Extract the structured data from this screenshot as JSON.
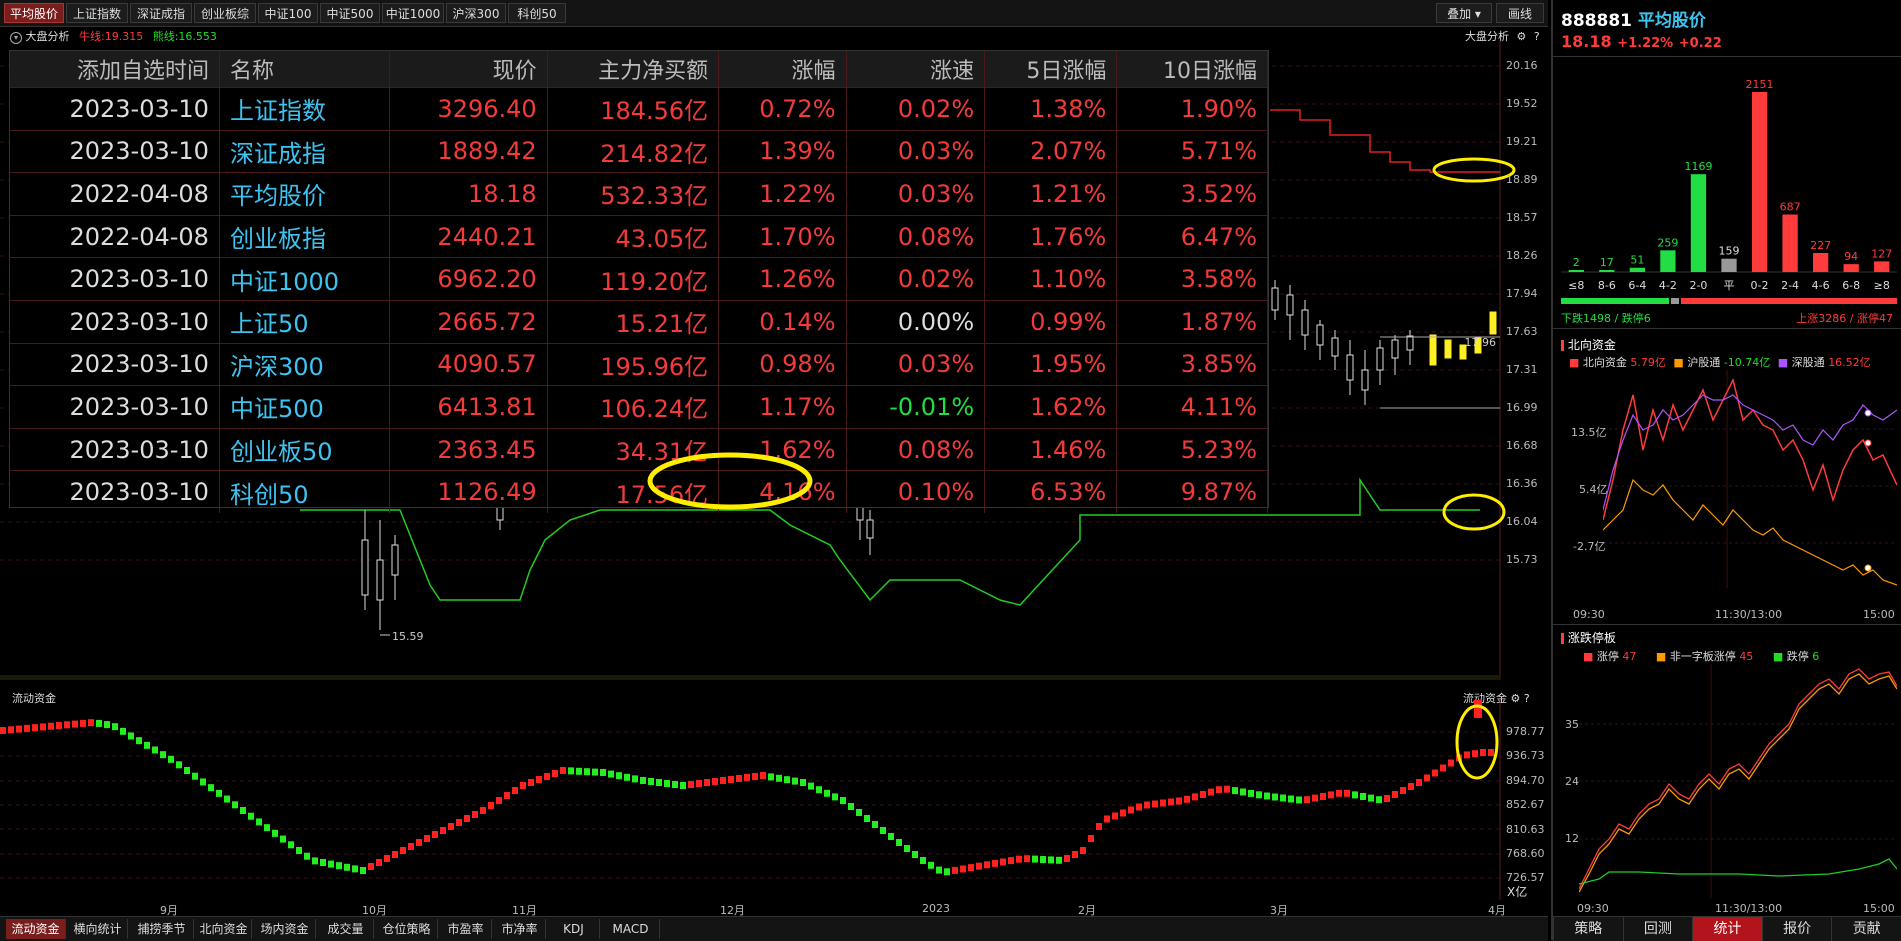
{
  "top_tabs": [
    "平均股价",
    "上证指数",
    "深证成指",
    "创业板综",
    "中证100",
    "中证500",
    "中证1000",
    "沪深300",
    "科创50"
  ],
  "active_top_tab": 0,
  "toolbar": {
    "overlay_label": "叠加",
    "line_label": "画线"
  },
  "main_header": {
    "title": "大盘分析",
    "mid_label": "牛线:19.315",
    "mid_color": "#ff3b3b",
    "low_label": "熊线:16.553",
    "low_color": "#22dd22",
    "right_title": "大盘分析"
  },
  "price_axis": [
    "20.16",
    "19.52",
    "19.21",
    "18.89",
    "18.57",
    "18.26",
    "17.94",
    "17.63",
    "17.31",
    "16.99",
    "16.68",
    "16.36",
    "16.04",
    "15.73"
  ],
  "annotations": {
    "low_label": "15.59",
    "price_mark": "17.96"
  },
  "table": {
    "headers": [
      "添加自选时间",
      "名称",
      "现价",
      "主力净买额",
      "涨幅",
      "涨速",
      "5日涨幅",
      "10日涨幅"
    ],
    "rows": [
      [
        "2023-03-10",
        "上证指数",
        "3296.40",
        "184.56亿",
        "0.72%",
        "0.02%",
        "1.38%",
        "1.90%"
      ],
      [
        "2023-03-10",
        "深证成指",
        "1889.42",
        "214.82亿",
        "1.39%",
        "0.03%",
        "2.07%",
        "5.71%"
      ],
      [
        "2022-04-08",
        "平均股价",
        "18.18",
        "532.33亿",
        "1.22%",
        "0.03%",
        "1.21%",
        "3.52%"
      ],
      [
        "2022-04-08",
        "创业板指",
        "2440.21",
        "43.05亿",
        "1.70%",
        "0.08%",
        "1.76%",
        "6.47%"
      ],
      [
        "2023-03-10",
        "中证1000",
        "6962.20",
        "119.20亿",
        "1.26%",
        "0.02%",
        "1.10%",
        "3.58%"
      ],
      [
        "2023-03-10",
        "上证50",
        "2665.72",
        "15.21亿",
        "0.14%",
        "0.00%",
        "0.99%",
        "1.87%"
      ],
      [
        "2023-03-10",
        "沪深300",
        "4090.57",
        "195.96亿",
        "0.98%",
        "0.03%",
        "1.95%",
        "3.85%"
      ],
      [
        "2023-03-10",
        "中证500",
        "6413.81",
        "106.24亿",
        "1.17%",
        "-0.01%",
        "1.62%",
        "4.11%"
      ],
      [
        "2023-03-10",
        "创业板50",
        "2363.45",
        "34.31亿",
        "1.62%",
        "0.08%",
        "1.46%",
        "5.23%"
      ],
      [
        "2023-03-10",
        "科创50",
        "1126.49",
        "17.56亿",
        "4.16%",
        "0.10%",
        "6.53%",
        "9.87%"
      ]
    ]
  },
  "flow": {
    "title": "流动资金",
    "right_title": "流动资金",
    "axis": [
      "978.77",
      "936.73",
      "894.70",
      "852.67",
      "810.63",
      "768.60",
      "726.57"
    ],
    "unit": "X亿"
  },
  "months": [
    "9月",
    "10月",
    "11月",
    "12月",
    "2023",
    "2月",
    "3月",
    "4月"
  ],
  "bottom_tabs": [
    "流动资金",
    "横向统计",
    "捕捞季节",
    "北向资金",
    "场内资金",
    "成交量",
    "仓位策略",
    "市盈率",
    "市净率",
    "KDJ",
    "MACD"
  ],
  "active_bottom_tab": 0,
  "right": {
    "code": "888881",
    "name": "平均股价",
    "price": "18.18",
    "pct": "+1.22%",
    "chg": "+0.22",
    "dist": {
      "chart_data": {
        "type": "bar",
        "categories": [
          "≤8",
          "8-6",
          "6-4",
          "4-2",
          "2-0",
          "平",
          "0-2",
          "2-4",
          "4-6",
          "6-8",
          "≥8"
        ],
        "values": [
          2,
          17,
          51,
          259,
          1169,
          159,
          2151,
          687,
          227,
          94,
          127
        ],
        "colors": [
          "#22dd44",
          "#22dd44",
          "#22dd44",
          "#22dd44",
          "#22dd44",
          "#999999",
          "#ff3b3b",
          "#ff3b3b",
          "#ff3b3b",
          "#ff3b3b",
          "#ff3b3b"
        ]
      },
      "down_text": "下跌1498 / 跌停6",
      "up_text": "上涨3286 / 涨停47"
    },
    "north": {
      "title": "北向资金",
      "legend": [
        {
          "label": "北向资金",
          "value": "5.79亿",
          "color": "#ff3b3b"
        },
        {
          "label": "沪股通",
          "value": "-10.74亿",
          "color": "#ff9900"
        },
        {
          "label": "深股通",
          "value": "16.52亿",
          "color": "#aa55ff"
        }
      ],
      "axis": [
        "13.5亿",
        "5.4亿",
        "-2.7亿"
      ],
      "times": [
        "09:30",
        "11:30/13:00",
        "15:00"
      ]
    },
    "limit": {
      "title": "涨跌停板",
      "legend": [
        {
          "label": "涨停",
          "value": "47",
          "color": "#ff3b3b"
        },
        {
          "label": "非一字板涨停",
          "value": "45",
          "color": "#ff9900"
        },
        {
          "label": "跌停",
          "value": "6",
          "color": "#22dd22"
        }
      ],
      "axis": [
        "35",
        "24",
        "12"
      ],
      "times": [
        "09:30",
        "11:30/13:00",
        "15:00"
      ]
    },
    "tabs": [
      "策略",
      "回测",
      "统计",
      "报价",
      "贡献"
    ],
    "active_tab": 2
  }
}
